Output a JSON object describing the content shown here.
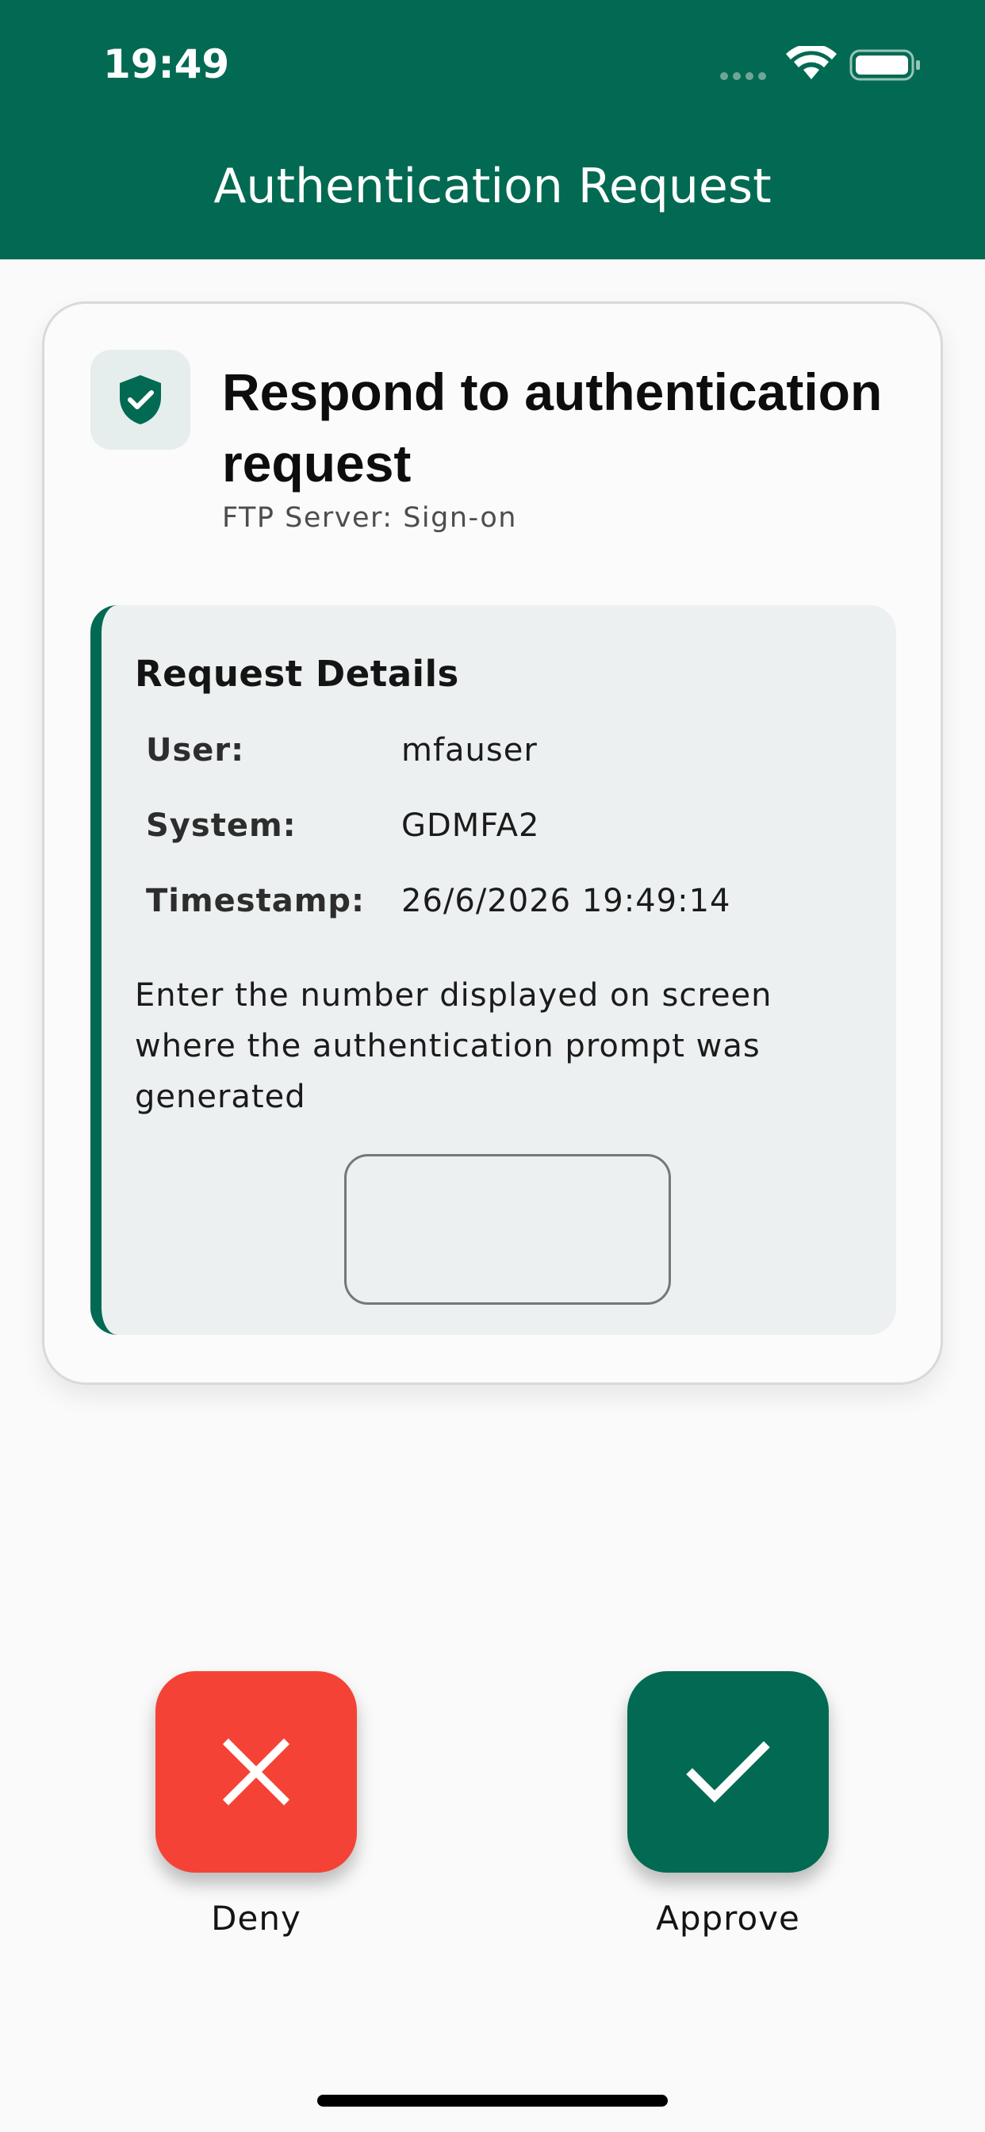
{
  "status_bar": {
    "time": "19:49",
    "icons": [
      "signal-icon",
      "wifi-icon",
      "battery-icon"
    ]
  },
  "header": {
    "title": "Authentication Request"
  },
  "card": {
    "icon": "shield-check-icon",
    "title": "Respond to authentication request",
    "subtitle": "FTP Server: Sign-on"
  },
  "details": {
    "heading": "Request Details",
    "rows": [
      {
        "label": "User:",
        "value": "mfauser"
      },
      {
        "label": "System:",
        "value": "GDMFA2"
      },
      {
        "label": "Timestamp:",
        "value": "26/6/2026 19:49:14"
      }
    ],
    "prompt": "Enter the number displayed on screen where the authentication prompt was generated",
    "number_input_value": ""
  },
  "actions": {
    "deny_label": "Deny",
    "approve_label": "Approve"
  },
  "colors": {
    "primary": "#026a52",
    "deny": "#f44336",
    "panel": "#ecf0f0",
    "background": "#fafafa"
  }
}
